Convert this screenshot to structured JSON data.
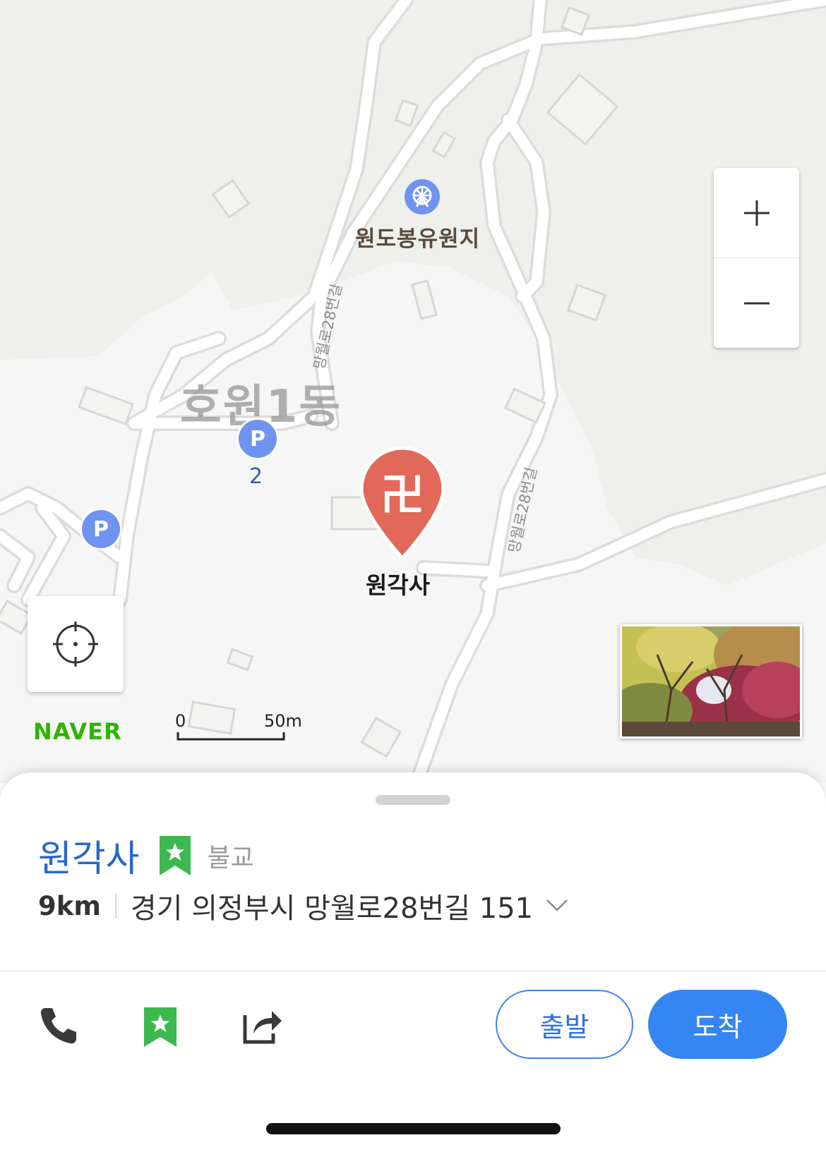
{
  "map": {
    "poi_name": "원도봉유원지",
    "district": "호원1동",
    "road_label_1": "망월로28번길",
    "road_label_2": "망월로28번길",
    "parking_symbol": "P",
    "parking_count": "2",
    "pin_symbol": "卍",
    "pin_label": "원각사",
    "logo": "NAVER",
    "scale_start": "0",
    "scale_end": "50m",
    "zoom_in_icon": "plus-icon",
    "zoom_out_icon": "minus-icon",
    "locate_icon": "crosshair-icon"
  },
  "place": {
    "name": "원각사",
    "category": "불교",
    "distance": "9km",
    "address": "경기 의정부시 망월로28번길 151",
    "bookmark_color": "#3cb94e",
    "name_color": "#2a67c6"
  },
  "actions": {
    "start_label": "출발",
    "arrive_label": "도착",
    "icons": [
      "phone-icon",
      "bookmark-star-icon",
      "share-icon"
    ],
    "accent": "#3585f2"
  }
}
